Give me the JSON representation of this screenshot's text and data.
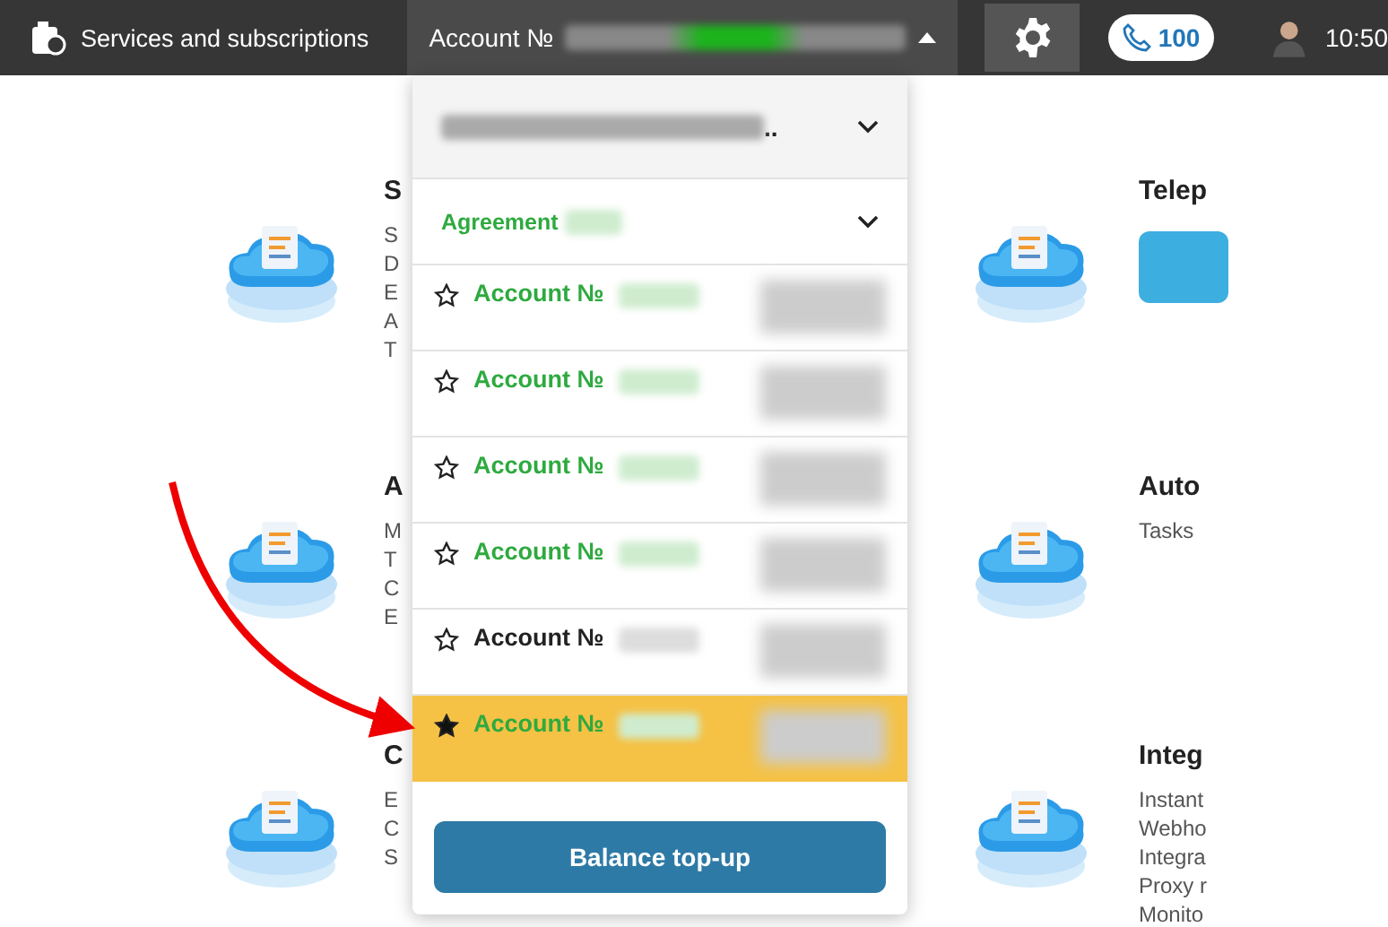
{
  "header": {
    "title": "Services and subscriptions",
    "account_label": "Account №",
    "counter": "100",
    "time": "10:50"
  },
  "dropdown": {
    "top_label": "..",
    "agreement": "Agreement",
    "accounts": [
      {
        "label": "Account №",
        "color": "#2eaa3f",
        "favorite": false,
        "selected": false
      },
      {
        "label": "Account №",
        "color": "#2eaa3f",
        "favorite": false,
        "selected": false
      },
      {
        "label": "Account №",
        "color": "#2eaa3f",
        "favorite": false,
        "selected": false
      },
      {
        "label": "Account №",
        "color": "#2eaa3f",
        "favorite": false,
        "selected": false
      },
      {
        "label": "Account №",
        "color": "#222222",
        "favorite": false,
        "selected": false
      },
      {
        "label": "Account №",
        "color": "#2eaa3f",
        "favorite": true,
        "selected": true
      }
    ],
    "button": "Balance top-up"
  },
  "left_cards": [
    {
      "heading": "S",
      "lines": [
        "S",
        "D",
        "E",
        "A",
        "T"
      ]
    },
    {
      "heading": "A",
      "lines": [
        "M",
        "T",
        "C",
        "E"
      ]
    },
    {
      "heading": "C",
      "lines": [
        "E",
        "C",
        "S"
      ]
    }
  ],
  "right_cards": [
    {
      "heading": "Telep",
      "kind": "button"
    },
    {
      "heading": "Auto",
      "kind": "list",
      "lines": [
        "Tasks"
      ]
    },
    {
      "heading": "Integ",
      "kind": "list",
      "lines": [
        "Instant",
        "Webho",
        "Integra",
        "Proxy r",
        "Monito"
      ]
    }
  ]
}
